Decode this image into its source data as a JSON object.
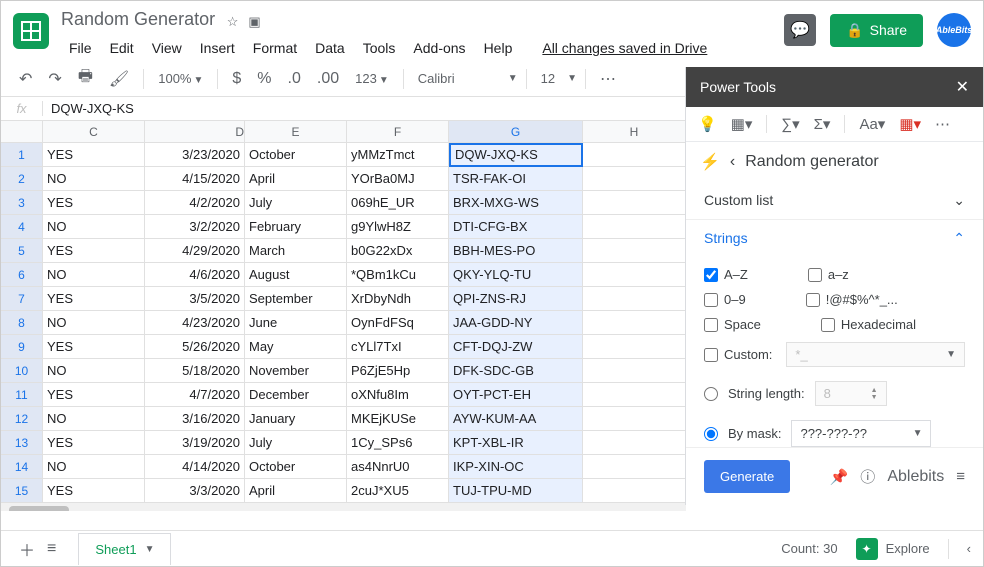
{
  "header": {
    "doc_title": "Random Generator",
    "saved_msg": "All changes saved in Drive",
    "share_label": "Share",
    "avatar_label": "AbleBits",
    "menus": [
      "File",
      "Edit",
      "View",
      "Insert",
      "Format",
      "Data",
      "Tools",
      "Add-ons",
      "Help"
    ]
  },
  "toolbar": {
    "zoom": "100%",
    "font": "Calibri",
    "font_size": "12",
    "number_hint": "123"
  },
  "formula_bar": {
    "label": "fx",
    "value": "DQW-JXQ-KS"
  },
  "grid": {
    "columns": [
      "C",
      "D",
      "E",
      "F",
      "G",
      "H"
    ],
    "selected_col": "G",
    "rows": [
      {
        "n": "1",
        "C": "YES",
        "D": "3/23/2020",
        "E": "October",
        "F": "yMMzTmct",
        "G": "DQW-JXQ-KS"
      },
      {
        "n": "2",
        "C": "NO",
        "D": "4/15/2020",
        "E": "April",
        "F": "YOrBa0MJ",
        "G": "TSR-FAK-OI"
      },
      {
        "n": "3",
        "C": "YES",
        "D": "4/2/2020",
        "E": "July",
        "F": "069hE_UR",
        "G": "BRX-MXG-WS"
      },
      {
        "n": "4",
        "C": "NO",
        "D": "3/2/2020",
        "E": "February",
        "F": "g9YlwH8Z",
        "G": "DTI-CFG-BX"
      },
      {
        "n": "5",
        "C": "YES",
        "D": "4/29/2020",
        "E": "March",
        "F": "b0G22xDx",
        "G": "BBH-MES-PO"
      },
      {
        "n": "6",
        "C": "NO",
        "D": "4/6/2020",
        "E": "August",
        "F": "*QBm1kCu",
        "G": "QKY-YLQ-TU"
      },
      {
        "n": "7",
        "C": "YES",
        "D": "3/5/2020",
        "E": "September",
        "F": "XrDbyNdh",
        "G": "QPI-ZNS-RJ"
      },
      {
        "n": "8",
        "C": "NO",
        "D": "4/23/2020",
        "E": "June",
        "F": "OynFdFSq",
        "G": "JAA-GDD-NY"
      },
      {
        "n": "9",
        "C": "YES",
        "D": "5/26/2020",
        "E": "May",
        "F": "cYLl7TxI",
        "G": "CFT-DQJ-ZW"
      },
      {
        "n": "10",
        "C": "NO",
        "D": "5/18/2020",
        "E": "November",
        "F": "P6ZjE5Hp",
        "G": "DFK-SDC-GB"
      },
      {
        "n": "11",
        "C": "YES",
        "D": "4/7/2020",
        "E": "December",
        "F": "oXNfu8Im",
        "G": "OYT-PCT-EH"
      },
      {
        "n": "12",
        "C": "NO",
        "D": "3/16/2020",
        "E": "January",
        "F": "MKEjKUSe",
        "G": "AYW-KUM-AA"
      },
      {
        "n": "13",
        "C": "YES",
        "D": "3/19/2020",
        "E": "July",
        "F": "1Cy_SPs6",
        "G": "KPT-XBL-IR"
      },
      {
        "n": "14",
        "C": "NO",
        "D": "4/14/2020",
        "E": "October",
        "F": "as4NnrU0",
        "G": "IKP-XIN-OC"
      },
      {
        "n": "15",
        "C": "YES",
        "D": "3/3/2020",
        "E": "April",
        "F": "2cuJ*XU5",
        "G": "TUJ-TPU-MD"
      }
    ]
  },
  "panel": {
    "title": "Power Tools",
    "tool_name": "Random generator",
    "section_custom": "Custom list",
    "section_strings": "Strings",
    "opt_AZ": "A–Z",
    "opt_az": "a–z",
    "opt_09": "0–9",
    "opt_sym": "!@#$%^*_...",
    "opt_space": "Space",
    "opt_hex": "Hexadecimal",
    "opt_custom": "Custom:",
    "custom_placeholder": "*_",
    "opt_len": "String length:",
    "len_placeholder": "8",
    "opt_mask": "By mask:",
    "mask_value": "???-???-??",
    "generate": "Generate",
    "brand": "Ablebits"
  },
  "bottom": {
    "sheet_name": "Sheet1",
    "count": "Count: 30",
    "explore": "Explore"
  }
}
